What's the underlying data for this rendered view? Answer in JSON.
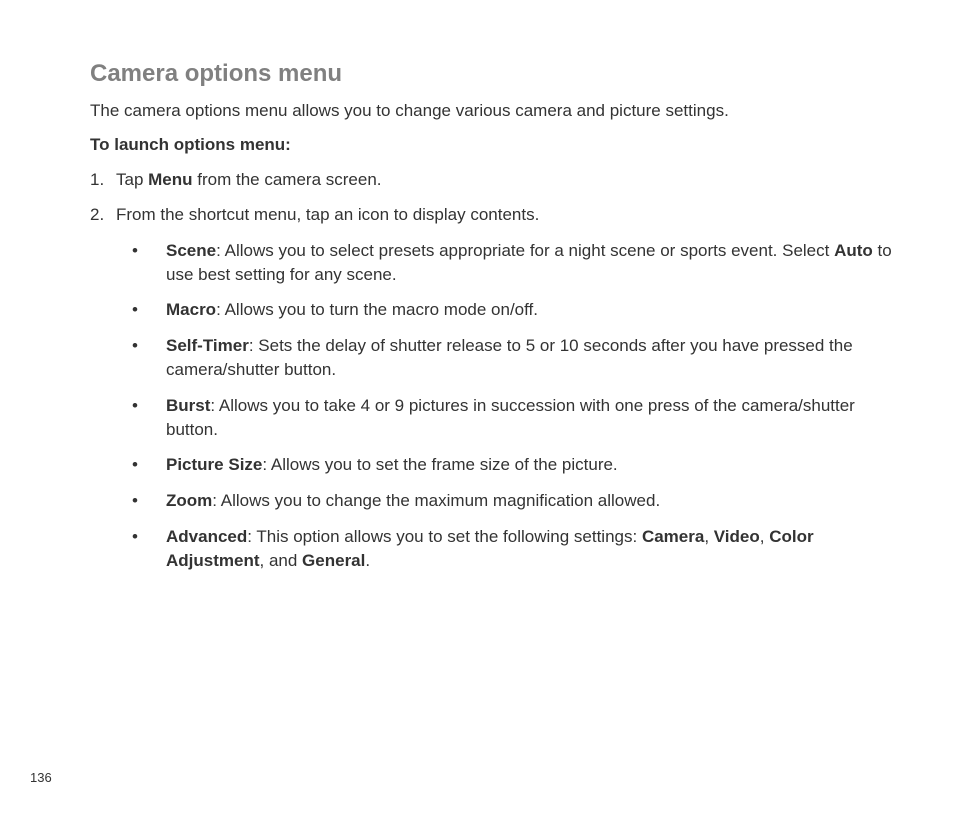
{
  "page_number": "136",
  "title": "Camera options menu",
  "intro": "The camera options menu allows you to change various camera and picture settings.",
  "sub_heading": "To launch options menu:",
  "steps": [
    {
      "num": "1.",
      "prefix": "Tap ",
      "bold1": "Menu",
      "suffix": " from the camera screen."
    },
    {
      "num": "2.",
      "text": "From the shortcut menu, tap an icon to display contents."
    }
  ],
  "bullets": [
    {
      "label": "Scene",
      "desc1": ": Allows you to select presets appropriate for a night scene or sports event. Select ",
      "bold2": "Auto",
      "desc2": " to use best setting for any scene."
    },
    {
      "label": "Macro",
      "desc1": ": Allows you to turn the macro mode on/off."
    },
    {
      "label": "Self-Timer",
      "desc1": ": Sets the delay of shutter release to 5 or 10 seconds after you have pressed the camera/shutter button."
    },
    {
      "label": "Burst",
      "desc1": ": Allows you to take 4 or 9 pictures in succession with one press of the camera/shutter button."
    },
    {
      "label": "Picture Size",
      "desc1": ": Allows you to set the frame size of the picture."
    },
    {
      "label": "Zoom",
      "desc1": ": Allows you to change the maximum magnification allowed."
    },
    {
      "label": "Advanced",
      "desc1": ": This option allows you to set the following settings: ",
      "bold2": "Camera",
      "sep2": ", ",
      "bold3": "Video",
      "sep3": ", ",
      "bold4": "Color Adjustment",
      "sep4": ", and ",
      "bold5": "General",
      "desc_end": "."
    }
  ]
}
